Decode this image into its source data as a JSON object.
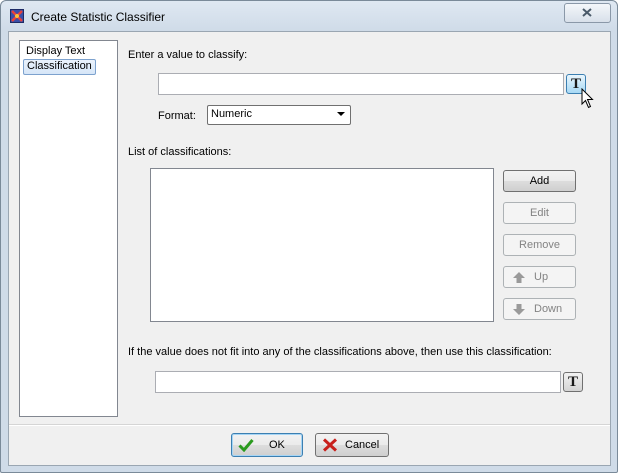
{
  "window": {
    "title": "Create Statistic Classifier"
  },
  "sidebar": {
    "items": [
      {
        "label": "Display Text",
        "selected": false
      },
      {
        "label": "Classification",
        "selected": true
      }
    ]
  },
  "classify": {
    "prompt": "Enter a value to classify:",
    "value": "",
    "text_button": "T",
    "format_label": "Format:",
    "format_value": "Numeric"
  },
  "classifications": {
    "label": "List of classifications:",
    "items": [],
    "buttons": {
      "add": "Add",
      "edit": "Edit",
      "remove": "Remove",
      "up": "Up",
      "down": "Down"
    }
  },
  "fallback": {
    "label": "If the value does not fit into any of the classifications above, then use this classification:",
    "value": "",
    "text_button": "T"
  },
  "footer": {
    "ok": "OK",
    "cancel": "Cancel"
  },
  "colors": {
    "ok_check": "#2a9a1e",
    "cancel_x": "#c8201c",
    "selection": "#d6e6f8"
  },
  "icons": {
    "app": "statistic-classifier-icon",
    "close": "close-icon",
    "up": "arrow-up-icon",
    "down": "arrow-down-icon"
  }
}
